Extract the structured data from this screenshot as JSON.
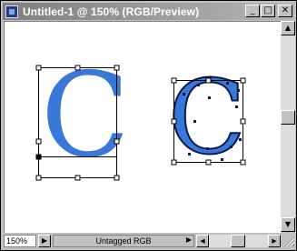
{
  "window": {
    "title": "Untitled-1 @ 150% (RGB/Preview)",
    "buttons": {
      "minimize": "_",
      "maximize": "□",
      "close": "✕"
    }
  },
  "canvas": {
    "letter_left": "C",
    "letter_right": "C",
    "letter_color": "#3a78d8",
    "letter_stroke": "#0a1a4a"
  },
  "vscroll": {
    "up": "▲",
    "down": "▼"
  },
  "status": {
    "zoom": "150%",
    "zoom_arrow": "▶",
    "info": "Untagged RGB",
    "info_arrow": "▶",
    "hscroll_left": "◀",
    "hscroll_right": "▶"
  }
}
